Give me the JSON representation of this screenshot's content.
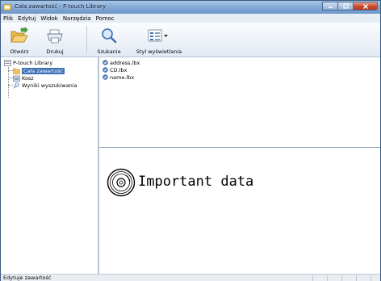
{
  "window": {
    "title": "Cała zawartość - P-touch Library"
  },
  "menu": [
    "Plik",
    "Edytuj",
    "Widok",
    "Narzędzia",
    "Pomoc"
  ],
  "toolbar": {
    "open_label": "Otwórz",
    "print_label": "Drukuj",
    "search_label": "Szukanie",
    "view_style_label": "Styl wyświetlania"
  },
  "tree": {
    "root": "P-touch Library",
    "items": [
      "Cała zawartość",
      "Kosz",
      "Wyniki wyszukiwania"
    ],
    "selected_index": 0
  },
  "files": [
    "address.lbx",
    "CD.lbx",
    "name.lbx"
  ],
  "preview": {
    "text": "Important data"
  },
  "status": {
    "text": "Edytuje zawartość"
  },
  "colors": {
    "selection": "#3d6fb5",
    "titlebar": "#7fa6d4",
    "close_button": "#c74a2e"
  },
  "icons": {
    "open": "folder-open-icon",
    "print": "printer-icon",
    "search": "magnifier-icon",
    "view_style": "list-view-icon"
  }
}
